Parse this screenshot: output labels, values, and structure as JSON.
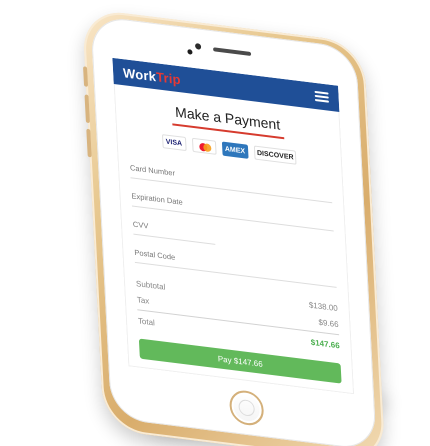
{
  "app": {
    "brand_left": "Work",
    "brand_right": "Trip",
    "menu_icon": "hamburger-menu-icon"
  },
  "payment": {
    "title": "Make a Payment",
    "card_logos": {
      "visa": "VISA",
      "amex": "AMEX",
      "discover": "DISCOVER"
    },
    "fields": {
      "card_number": "Card Number",
      "expiration_date": "Expiration Date",
      "cvv": "CVV",
      "postal_code": "Postal Code"
    },
    "summary": {
      "subtotal_label": "Subtotal",
      "subtotal_value": "$138.00",
      "tax_label": "Tax",
      "tax_value": "$9.66",
      "total_label": "Total",
      "total_value": "$147.66"
    },
    "pay_button": "Pay $147.66"
  },
  "colors": {
    "header_blue": "#1f4f97",
    "accent_red": "#d63b2e",
    "total_green": "#4caf50",
    "button_green": "#62b95b",
    "phone_gold": "#d9ad6c"
  }
}
